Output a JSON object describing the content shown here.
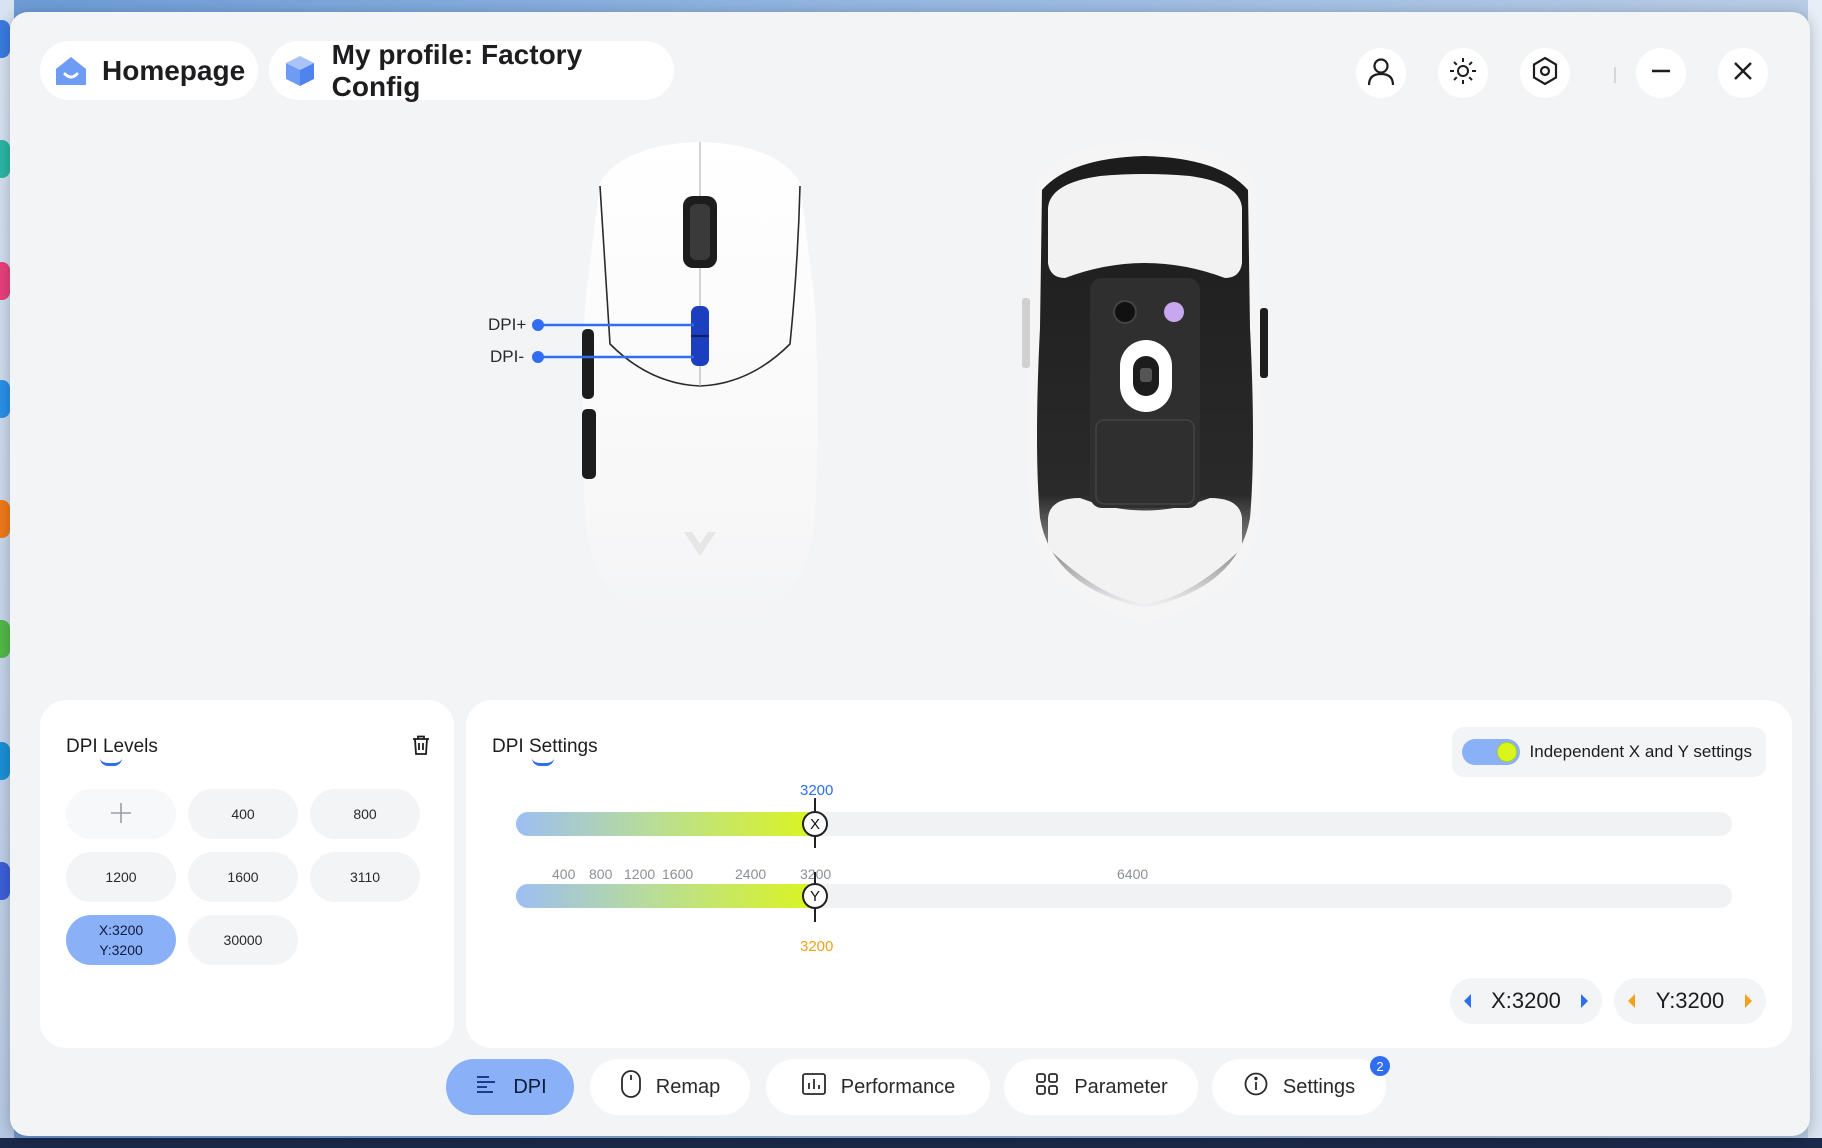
{
  "header": {
    "home_label": "Homepage",
    "profile_label": "My profile: Factory Config"
  },
  "header_icons": [
    "user-icon",
    "sun-lighting-icon",
    "hex-settings-icon",
    "minimize-icon",
    "close-icon"
  ],
  "mouse": {
    "dpi_plus_label": "DPI+",
    "dpi_minus_label": "DPI-"
  },
  "dpi_levels": {
    "title": "DPI Levels",
    "items": [
      "400",
      "800",
      "1200",
      "1600",
      "3110",
      "30000"
    ],
    "active_x": "X:3200",
    "active_y": "Y:3200"
  },
  "dpi_settings": {
    "title": "DPI Settings",
    "toggle_label": "Independent X and Y settings",
    "toggle_on": true,
    "x_value_label": "3200",
    "y_value_label": "3200",
    "x_knob": "X",
    "y_knob": "Y",
    "slider_ticks": [
      "400",
      "800",
      "1200",
      "1600",
      "2400",
      "3200",
      "6400"
    ],
    "x_stepper": "X:3200",
    "y_stepper": "Y:3200",
    "fill_fraction": 0.249
  },
  "colors": {
    "accent_blue": "#2f6ef2",
    "active_pill": "#8ab1f7",
    "slider_yellow": "#dcf51c",
    "y_orange": "#f0a21a"
  },
  "tabs": [
    {
      "label": "DPI",
      "icon": "dpi-icon",
      "active": true
    },
    {
      "label": "Remap",
      "icon": "mouse-icon",
      "active": false
    },
    {
      "label": "Performance",
      "icon": "chart-icon",
      "active": false
    },
    {
      "label": "Parameter",
      "icon": "grid-icon",
      "active": false
    },
    {
      "label": "Settings",
      "icon": "info-icon",
      "active": false
    }
  ],
  "settings_badge": "2"
}
